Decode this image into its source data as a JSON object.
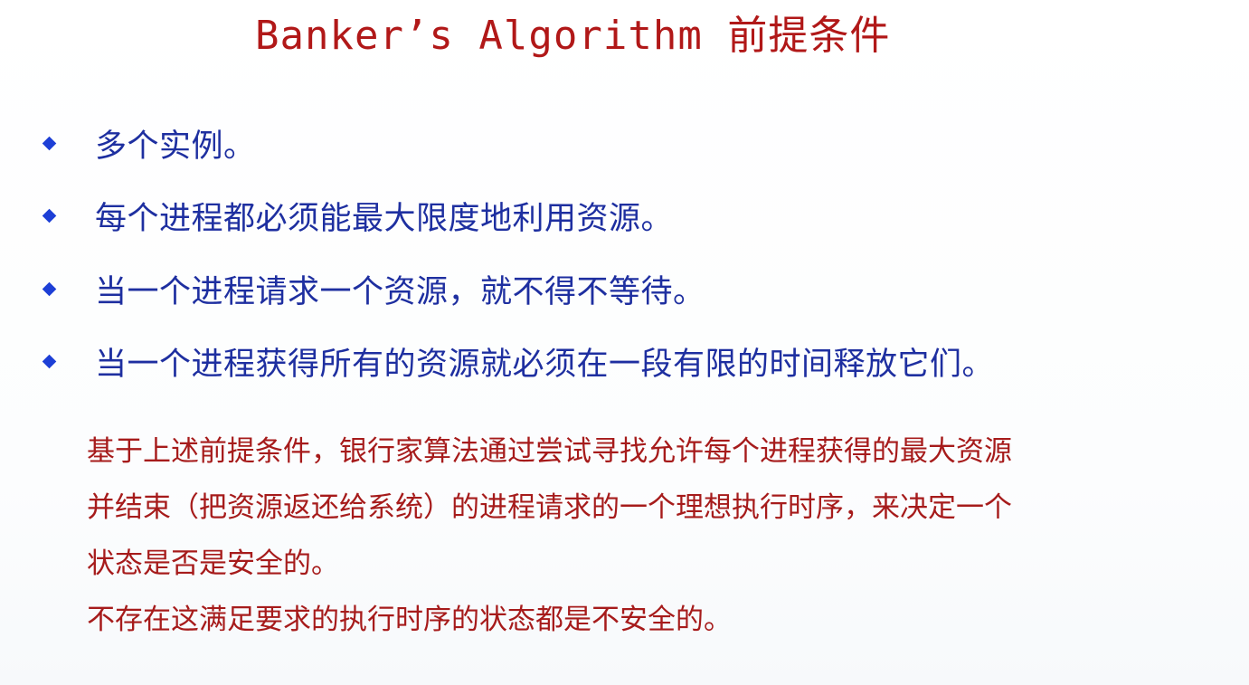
{
  "slide": {
    "title": "Banker’s Algorithm 前提条件",
    "bullets": [
      "多个实例。",
      "每个进程都必须能最大限度地利用资源。",
      "当一个进程请求一个资源，就不得不等待。",
      "当一个进程获得所有的资源就必须在一段有限的时间释放它们。"
    ],
    "note_lines": [
      "基于上述前提条件，银行家算法通过尝试寻找允许每个进程获得的最大资源",
      "并结束（把资源返还给系统）的进程请求的一个理想执行时序，来决定一个",
      "状态是否是安全的。",
      "不存在这满足要求的执行时序的状态都是不安全的。"
    ]
  },
  "colors": {
    "title": "#b11818",
    "bullet_text": "#1e2fa0",
    "bullet_marker": "#1d3fd6",
    "note_text": "#a61b1b"
  },
  "icons": {
    "bullet_marker": "diamond"
  }
}
